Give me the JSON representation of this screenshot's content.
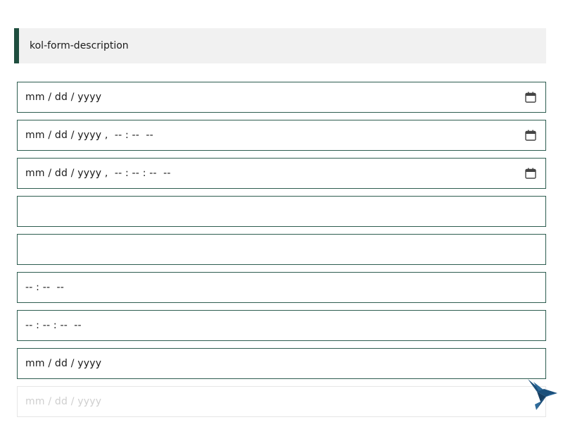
{
  "description": {
    "text": "kol-form-description"
  },
  "fields": [
    {
      "value": "mm / dd / yyyy",
      "has_calendar": true
    },
    {
      "value": "mm / dd / yyyy ,  -- : --  --",
      "has_calendar": true
    },
    {
      "value": "mm / dd / yyyy ,  -- : -- : --  --",
      "has_calendar": true
    },
    {
      "value": ""
    },
    {
      "value": ""
    },
    {
      "value": "-- : --  --"
    },
    {
      "value": "-- : -- : --  --"
    },
    {
      "value": "mm / dd / yyyy"
    },
    {
      "value": "mm / dd / yyyy",
      "disabled": true
    }
  ],
  "icons": {
    "calendar": "calendar-icon",
    "logo": "hummingbird-logo-icon"
  },
  "colors": {
    "border": "#2e5d50",
    "accent_bar": "#1f4e3f",
    "description_bg": "#f1f1f1",
    "logo": "#1b4f7a"
  }
}
